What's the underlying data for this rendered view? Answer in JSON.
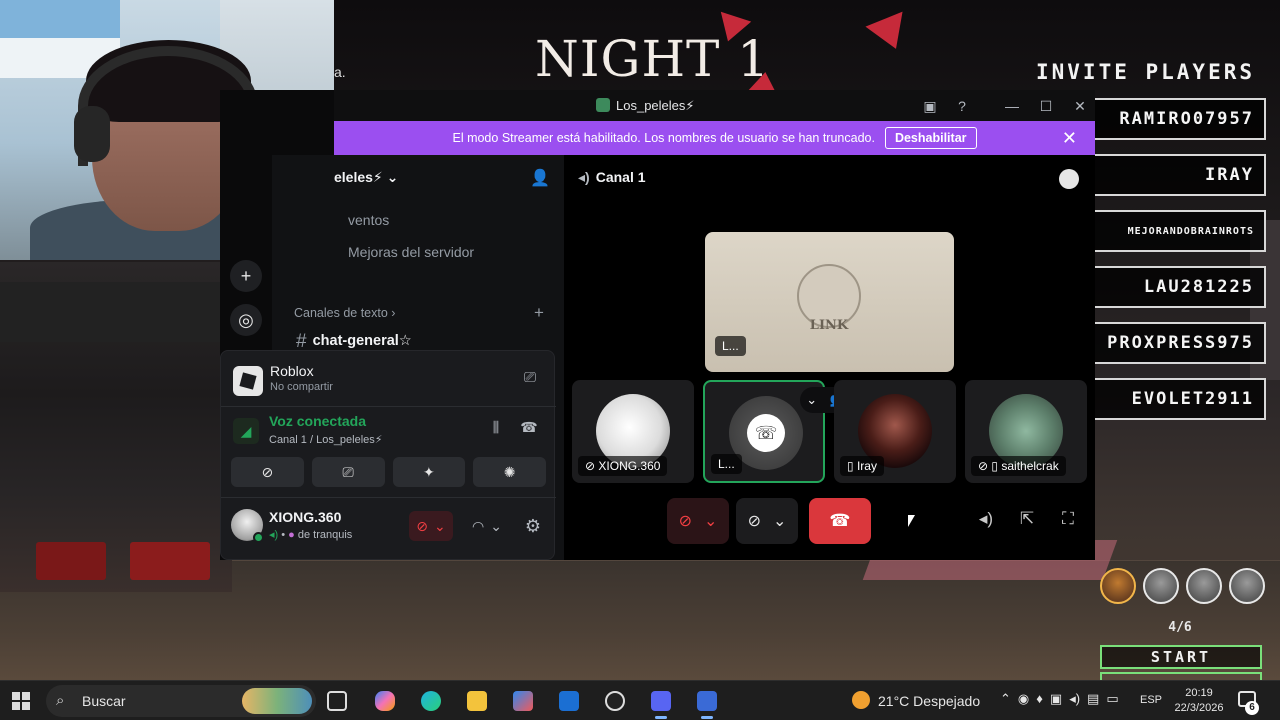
{
  "game": {
    "title": "NIGHT 1",
    "partial_text": "a.",
    "invite_title": "INVITE PLAYERS",
    "players": [
      "RAMIRO07957",
      "IRAY",
      "MEJORANDOBRAINROTS",
      "LAU281225",
      "PROXPRESS975",
      "EVOLET2911"
    ],
    "count": "4/6",
    "start_label": "START"
  },
  "discord": {
    "window_title": "Los_peleles⚡",
    "banner": {
      "text": "El modo Streamer está habilitado. Los nombres de usuario se han truncado.",
      "button": "Deshabilitar"
    },
    "server_name": "eleles⚡",
    "channels": {
      "events": "ventos",
      "boosts": "Mejoras del servidor",
      "category": "Canales de texto",
      "chat": "chat-general☆"
    },
    "activity": {
      "name": "Roblox",
      "sub": "No compartir"
    },
    "voice": {
      "status": "Voz conectada",
      "channel": "Canal 1 / Los_peleles⚡"
    },
    "user": {
      "name": "XIONG.360",
      "status": "de tranquis"
    },
    "main": {
      "channel": "Canal 1",
      "stage_label": "L...",
      "stage_logo": "LINK",
      "tiles": [
        {
          "label": "XIONG.360"
        },
        {
          "label": "L..."
        },
        {
          "label": "Iray"
        },
        {
          "label": "saithelcrak"
        }
      ]
    }
  },
  "taskbar": {
    "search": "Buscar",
    "weather": "21°C  Despejado",
    "lang": "ESP",
    "time": "20:19",
    "date": "22/3/2026",
    "notifications": "6"
  },
  "colors": {
    "banner": "#9b4ff0",
    "voice_green": "#23a55a",
    "danger_red": "#da373c",
    "start_border": "#7ae07a"
  }
}
